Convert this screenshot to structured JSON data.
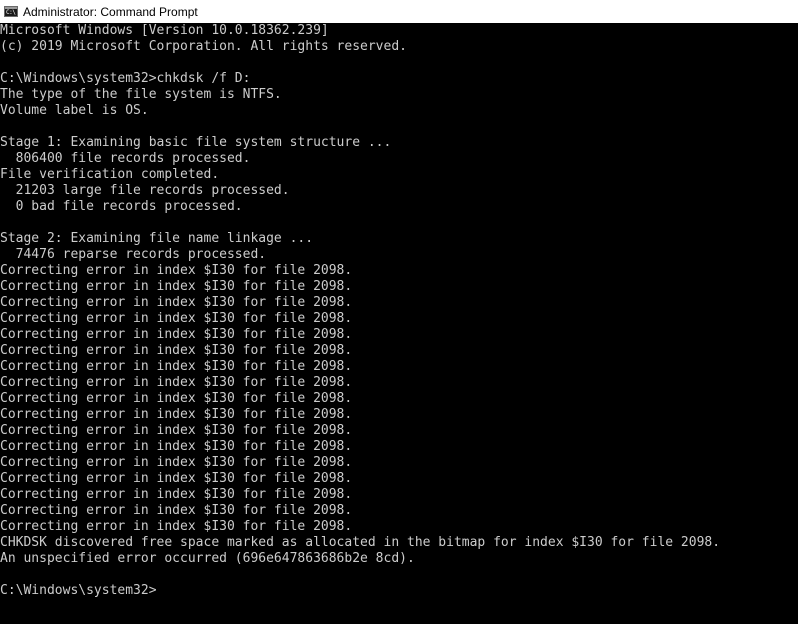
{
  "window": {
    "title": "Administrator: Command Prompt",
    "icon": "console-icon",
    "icon_text": "C:\\"
  },
  "colors": {
    "background": "#000000",
    "foreground": "#cccccc",
    "titlebar": "#ffffff"
  },
  "console": {
    "lines": [
      "Microsoft Windows [Version 10.0.18362.239]",
      "(c) 2019 Microsoft Corporation. All rights reserved.",
      "",
      "C:\\Windows\\system32>chkdsk /f D:",
      "The type of the file system is NTFS.",
      "Volume label is OS.",
      "",
      "Stage 1: Examining basic file system structure ...",
      "  806400 file records processed.",
      "File verification completed.",
      "  21203 large file records processed.",
      "  0 bad file records processed.",
      "",
      "Stage 2: Examining file name linkage ...",
      "  74476 reparse records processed.",
      "Correcting error in index $I30 for file 2098.",
      "Correcting error in index $I30 for file 2098.",
      "Correcting error in index $I30 for file 2098.",
      "Correcting error in index $I30 for file 2098.",
      "Correcting error in index $I30 for file 2098.",
      "Correcting error in index $I30 for file 2098.",
      "Correcting error in index $I30 for file 2098.",
      "Correcting error in index $I30 for file 2098.",
      "Correcting error in index $I30 for file 2098.",
      "Correcting error in index $I30 for file 2098.",
      "Correcting error in index $I30 for file 2098.",
      "Correcting error in index $I30 for file 2098.",
      "Correcting error in index $I30 for file 2098.",
      "Correcting error in index $I30 for file 2098.",
      "Correcting error in index $I30 for file 2098.",
      "Correcting error in index $I30 for file 2098.",
      "Correcting error in index $I30 for file 2098.",
      "CHKDSK discovered free space marked as allocated in the bitmap for index $I30 for file 2098.",
      "An unspecified error occurred (696e647863686b2e 8cd).",
      "",
      "C:\\Windows\\system32>"
    ]
  }
}
